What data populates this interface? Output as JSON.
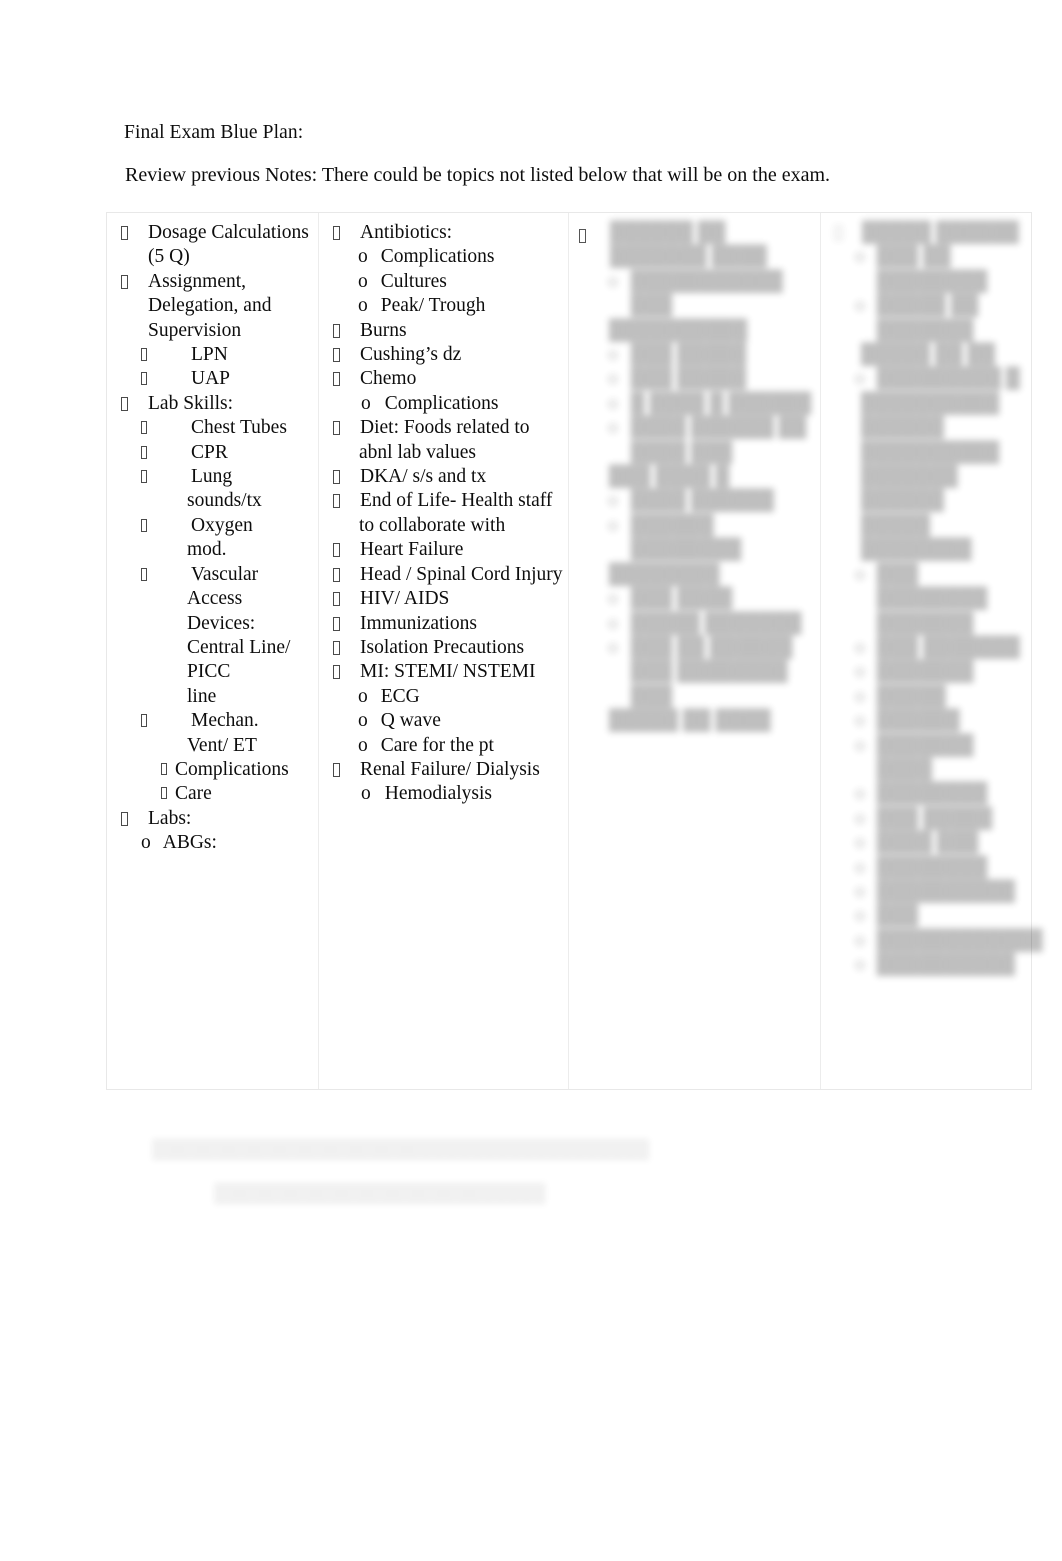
{
  "document": {
    "title": "Final Exam Blue Plan:",
    "subtitle": "Review previous Notes: There could be topics not listed below that will be on the exam.",
    "background_color": "#ffffff",
    "text_color": "#0d0d0d",
    "table_border_color": "#e8e8e8"
  },
  "table": {
    "columns": 4,
    "column_1": {
      "items": [
        {
          "level": 1,
          "bullet": "missing-glyph-box",
          "text": "Dosage Calculations"
        },
        {
          "level": 1,
          "bullet": "continuation",
          "text": "(5 Q)"
        },
        {
          "level": 1,
          "bullet": "missing-glyph-box",
          "text": "Assignment,"
        },
        {
          "level": 1,
          "bullet": "continuation",
          "text": "Delegation, and"
        },
        {
          "level": 1,
          "bullet": "continuation",
          "text": "Supervision"
        },
        {
          "level": 2,
          "bullet": "missing-glyph-box",
          "text": "LPN"
        },
        {
          "level": 2,
          "bullet": "missing-glyph-box",
          "text": "UAP"
        },
        {
          "level": 1,
          "bullet": "missing-glyph-box",
          "text": "Lab Skills:"
        },
        {
          "level": 2,
          "bullet": "missing-glyph-box",
          "text": "Chest Tubes"
        },
        {
          "level": 2,
          "bullet": "missing-glyph-box",
          "text": "CPR"
        },
        {
          "level": 2,
          "bullet": "missing-glyph-box",
          "text": "Lung"
        },
        {
          "level": 2,
          "bullet": "continuation",
          "text": "sounds/tx"
        },
        {
          "level": 2,
          "bullet": "missing-glyph-box",
          "text": "Oxygen"
        },
        {
          "level": 2,
          "bullet": "continuation",
          "text": "mod."
        },
        {
          "level": 2,
          "bullet": "missing-glyph-box",
          "text": "Vascular"
        },
        {
          "level": 2,
          "bullet": "continuation",
          "text": "Access Devices:"
        },
        {
          "level": 2,
          "bullet": "continuation",
          "text": "Central Line/ PICC"
        },
        {
          "level": 2,
          "bullet": "continuation",
          "text": "line"
        },
        {
          "level": 2,
          "bullet": "missing-glyph-box",
          "text": "Mechan."
        },
        {
          "level": 2,
          "bullet": "continuation",
          "text": "Vent/ ET"
        },
        {
          "level": 3,
          "bullet": "missing-glyph-box",
          "text": "Complications"
        },
        {
          "level": 3,
          "bullet": "missing-glyph-box",
          "text": "Care"
        },
        {
          "level": 1,
          "bullet": "missing-glyph-box",
          "text": "Labs:"
        },
        {
          "level": 2,
          "bullet": "o",
          "text": "ABGs:"
        }
      ]
    },
    "column_2": {
      "items": [
        {
          "level": 1,
          "bullet": "missing-glyph-box",
          "text": "Antibiotics:"
        },
        {
          "level": 2,
          "bullet": "o",
          "text": "Complications"
        },
        {
          "level": 2,
          "bullet": "o",
          "text": "Cultures"
        },
        {
          "level": 2,
          "bullet": "o",
          "text": "Peak/ Trough"
        },
        {
          "level": 1,
          "bullet": "missing-glyph-box",
          "text": "Burns"
        },
        {
          "level": 1,
          "bullet": "missing-glyph-box",
          "text": "Cushing’s dz"
        },
        {
          "level": 1,
          "bullet": "missing-glyph-box",
          "text": "Chemo"
        },
        {
          "level": 2,
          "bullet": "o",
          "text": "Complications"
        },
        {
          "level": 1,
          "bullet": "missing-glyph-box",
          "text": "Diet: Foods related to"
        },
        {
          "level": 1,
          "bullet": "continuation",
          "text": "abnl lab values"
        },
        {
          "level": 1,
          "bullet": "missing-glyph-box",
          "text": "DKA/ s/s and tx"
        },
        {
          "level": 1,
          "bullet": "missing-glyph-box",
          "text": "End of Life- Health staff"
        },
        {
          "level": 1,
          "bullet": "continuation",
          "text": "to collaborate with"
        },
        {
          "level": 1,
          "bullet": "missing-glyph-box",
          "text": "Heart Failure"
        },
        {
          "level": 1,
          "bullet": "missing-glyph-box",
          "text": "Head / Spinal Cord Injury"
        },
        {
          "level": 1,
          "bullet": "missing-glyph-box",
          "text": "HIV/ AIDS"
        },
        {
          "level": 1,
          "bullet": "missing-glyph-box",
          "text": "Immunizations"
        },
        {
          "level": 1,
          "bullet": "missing-glyph-box",
          "text": "Isolation Precautions"
        },
        {
          "level": 1,
          "bullet": "missing-glyph-box",
          "text": "MI: STEMI/ NSTEMI"
        },
        {
          "level": 2,
          "bullet": "o",
          "text": "ECG"
        },
        {
          "level": 2,
          "bullet": "o",
          "text": "Q wave"
        },
        {
          "level": 2,
          "bullet": "o",
          "text": "Care for the pt"
        },
        {
          "level": 1,
          "bullet": "missing-glyph-box",
          "text": "Renal Failure/ Dialysis"
        },
        {
          "level": 2,
          "bullet": "o",
          "text": "Hemodialysis"
        }
      ]
    },
    "column_3": {
      "redacted": true,
      "note": "Text in this column is blurred/illegible in the source image",
      "items": [
        {
          "level": 1,
          "bullet": "missing-glyph-box",
          "text": "██████ ██ ███████ ████"
        },
        {
          "level": 2,
          "bullet": "o",
          "text": "███████████ ███"
        },
        {
          "level": 2,
          "bullet": "continuation",
          "text": "██████████"
        },
        {
          "level": 2,
          "bullet": "o",
          "text": "███ █████"
        },
        {
          "level": 2,
          "bullet": "o",
          "text": "███ █████"
        },
        {
          "level": 2,
          "bullet": "o",
          "text": "█ ████ █ ██████"
        },
        {
          "level": 2,
          "bullet": "o",
          "text": "████ ██████ ██ ████ ███"
        },
        {
          "level": 2,
          "bullet": "continuation",
          "text": "███ ████ █"
        },
        {
          "level": 2,
          "bullet": "o",
          "text": "████ ██████"
        },
        {
          "level": 2,
          "bullet": "o",
          "text": "██████ ████████"
        },
        {
          "level": 2,
          "bullet": "continuation",
          "text": "████████"
        },
        {
          "level": 2,
          "bullet": "o",
          "text": "███ ████"
        },
        {
          "level": 2,
          "bullet": "o",
          "text": "█████ ███████"
        },
        {
          "level": 2,
          "bullet": "o",
          "text": "███ ██ ██████ ███ ████████ ███"
        },
        {
          "level": 2,
          "bullet": "continuation",
          "text": "█████ ██ ████"
        }
      ]
    },
    "column_4": {
      "redacted": true,
      "note": "Text in this column is blurred/illegible in the source image",
      "items": [
        {
          "level": 1,
          "bullet": "missing-glyph-box",
          "text": "█████ ██████"
        },
        {
          "level": 2,
          "bullet": "o",
          "text": "███ ██ ████████"
        },
        {
          "level": 2,
          "bullet": "o",
          "text": "█████ ██ ███████"
        },
        {
          "level": 2,
          "bullet": "continuation",
          "text": "█████ ██ ██"
        },
        {
          "level": 2,
          "bullet": "o",
          "text": "█████████ █"
        },
        {
          "level": 2,
          "bullet": "continuation",
          "text": "██████████"
        },
        {
          "level": 2,
          "bullet": "continuation",
          "text": "██████"
        },
        {
          "level": 2,
          "bullet": "continuation",
          "text": "██████████"
        },
        {
          "level": 2,
          "bullet": "continuation",
          "text": "███████ ██████"
        },
        {
          "level": 2,
          "bullet": "continuation",
          "text": "█████ ████████"
        },
        {
          "level": 2,
          "bullet": "o",
          "text": "███ ████████ ███████"
        },
        {
          "level": 2,
          "bullet": "o",
          "text": "███ ███████"
        },
        {
          "level": 2,
          "bullet": "o",
          "text": "███████"
        },
        {
          "level": 2,
          "bullet": "o",
          "text": "█████"
        },
        {
          "level": 2,
          "bullet": "o",
          "text": "██████"
        },
        {
          "level": 2,
          "bullet": "o",
          "text": "███████ ████"
        },
        {
          "level": 2,
          "bullet": "o",
          "text": "████████"
        },
        {
          "level": 2,
          "bullet": "o",
          "text": "███ █████"
        },
        {
          "level": 2,
          "bullet": "o",
          "text": "████ ███"
        },
        {
          "level": 2,
          "bullet": "o",
          "text": "████████"
        },
        {
          "level": 2,
          "bullet": "o",
          "text": "██████████"
        },
        {
          "level": 2,
          "bullet": "o",
          "text": "███"
        },
        {
          "level": 2,
          "bullet": "o",
          "text": "████████████"
        },
        {
          "level": 2,
          "bullet": "o",
          "text": "██████████"
        }
      ]
    }
  },
  "footer": {
    "redacted": true,
    "note": "Two very faint blurred text lines below the table; illegible in the source image",
    "line_1": "███████████████████████████████████████",
    "line_2": "██████████████████████████"
  }
}
